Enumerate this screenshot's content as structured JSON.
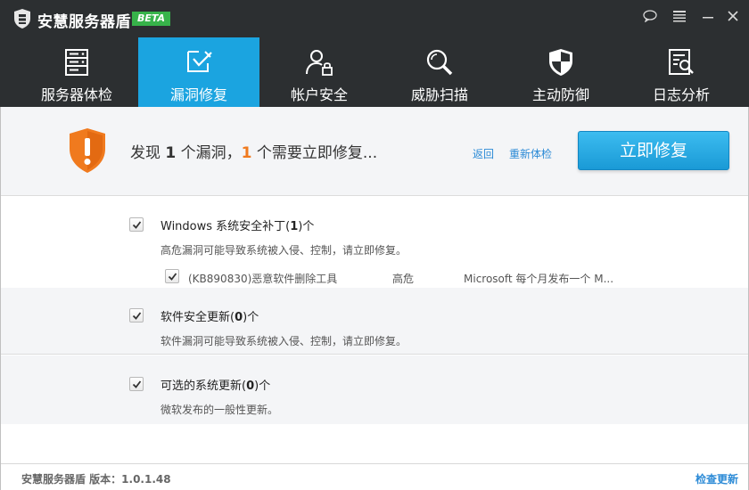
{
  "app": {
    "title": "安慧服务器盾",
    "beta": "BETA"
  },
  "window_controls": [
    "chat-icon",
    "menu-icon",
    "minimize-icon",
    "close-icon"
  ],
  "nav": {
    "tabs": [
      {
        "label": "服务器体检",
        "icon": "server-icon",
        "active": false
      },
      {
        "label": "漏洞修复",
        "icon": "wrench-icon",
        "active": true
      },
      {
        "label": "帐户安全",
        "icon": "user-lock-icon",
        "active": false
      },
      {
        "label": "威胁扫描",
        "icon": "magnifier-icon",
        "active": false
      },
      {
        "label": "主动防御",
        "icon": "shield-icon",
        "active": false
      },
      {
        "label": "日志分析",
        "icon": "log-search-icon",
        "active": false
      }
    ]
  },
  "banner": {
    "prefix": "发现 ",
    "vuln_count": "1",
    "middle": " 个漏洞，",
    "urgent_count": "1",
    "suffix": " 个需要立即修复...",
    "back_link": "返回",
    "recheck_link": "重新体检",
    "fix_button": "立即修复"
  },
  "sections": [
    {
      "title_prefix": "Windows 系统安全补丁(",
      "count": "1",
      "title_suffix": ")个",
      "desc": "高危漏洞可能导致系统被入侵、控制，请立即修复。",
      "items": [
        {
          "name": "(KB890830)恶意软件删除工具",
          "level": "高危",
          "desc": "Microsoft 每个月发布一个 M..."
        }
      ]
    },
    {
      "title_prefix": "软件安全更新(",
      "count": "0",
      "title_suffix": ")个",
      "desc": "软件漏洞可能导致系统被入侵、控制，请立即修复。",
      "items": []
    },
    {
      "title_prefix": "可选的系统更新(",
      "count": "0",
      "title_suffix": ")个",
      "desc": "微软发布的一般性更新。",
      "items": []
    }
  ],
  "status": {
    "version": "安慧服务器盾 版本：1.0.1.48",
    "check_update": "检查更新"
  },
  "colors": {
    "titlebar": "#2c2f31",
    "active_tab": "#1ba4e0",
    "accent_orange": "#f07a1e",
    "link_blue": "#2b8ad6",
    "beta_green": "#37b34a"
  }
}
